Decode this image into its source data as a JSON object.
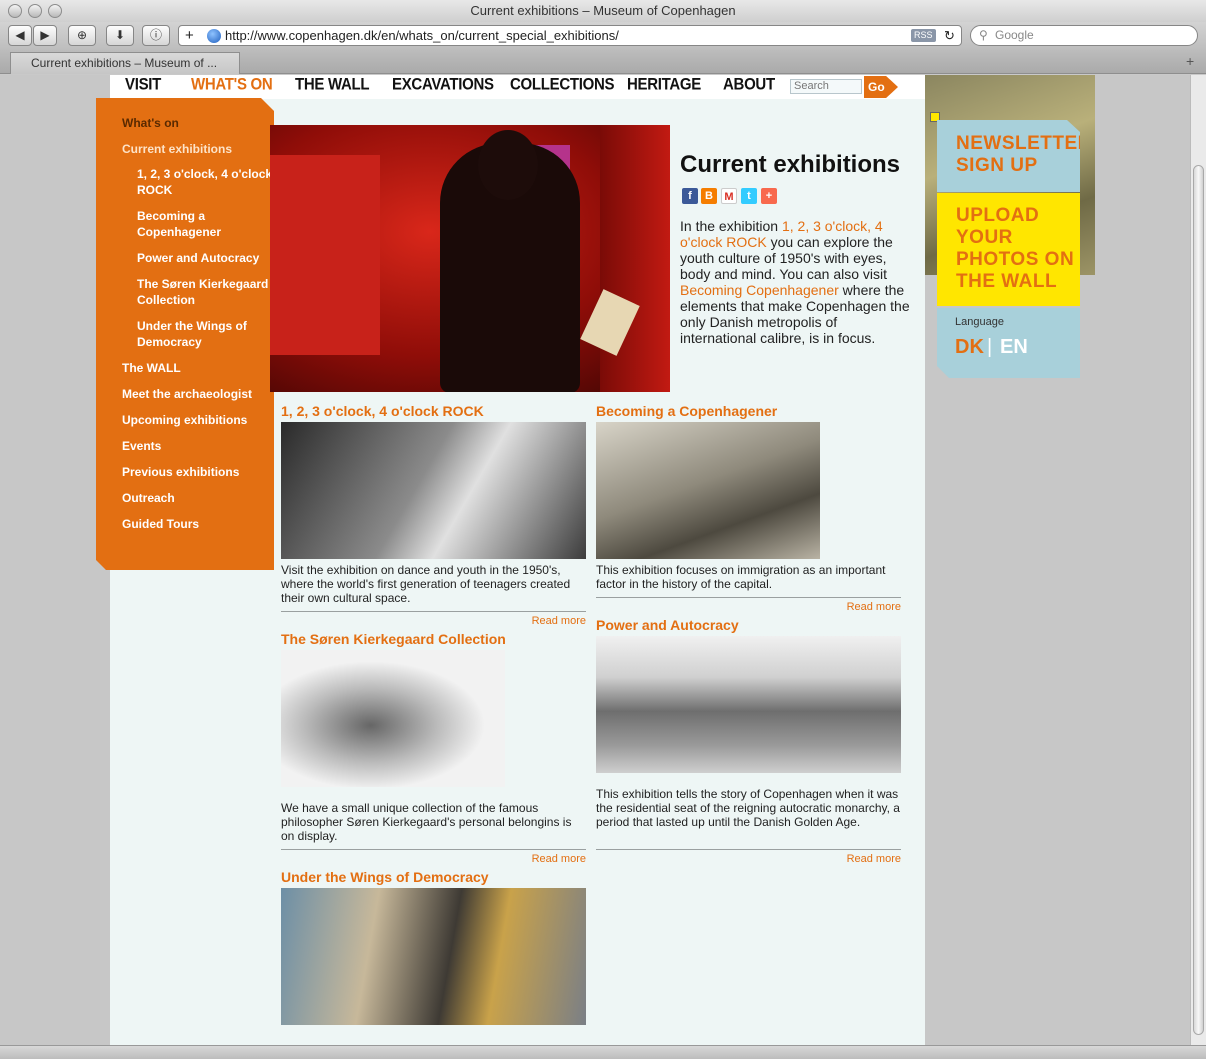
{
  "window": {
    "title": "Current exhibitions – Museum of Copenhagen"
  },
  "browser": {
    "url": "http://www.copenhagen.dk/en/whats_on/current_special_exhibitions/",
    "rss": "RSS",
    "search_placeholder": "Google",
    "tab_label": "Current exhibitions – Museum of ..."
  },
  "nav": {
    "items": [
      "VISIT",
      "WHAT'S ON",
      "THE WALL",
      "EXCAVATIONS",
      "COLLECTIONS",
      "HERITAGE",
      "ABOUT"
    ],
    "search_placeholder": "Search",
    "go": "Go"
  },
  "submenu": {
    "head": "What's on",
    "current": "Current exhibitions",
    "sub": [
      "1, 2, 3 o'clock, 4 o'clock ROCK",
      "Becoming a Copenhagener",
      "Power and Autocracy",
      "The Søren Kierkegaard Collection",
      "Under the Wings of Democracy"
    ],
    "items": [
      "The WALL",
      "Meet the archaeologist",
      "Upcoming exhibitions",
      "Events",
      "Previous exhibitions",
      "Outreach",
      "Guided Tours"
    ]
  },
  "main": {
    "title": "Current exhibitions",
    "intro": {
      "p1": "In the exhibition ",
      "link1": "1, 2, 3 o'clock, 4 o'clock ROCK",
      "p2": " you can explore the youth culture of 1950's with eyes, body and mind. You can also visit ",
      "link2": "Becoming Copenhagener",
      "p3": " where the elements that make Copenhagen the only Danish metropolis of international calibre, is in focus."
    },
    "exhibitions": [
      {
        "title": "1, 2, 3 o'clock, 4 o'clock ROCK",
        "desc": "Visit the exhibition on dance and youth in the 1950's, where the world's first generation of teenagers created their own cultural space.",
        "readmore": "Read more"
      },
      {
        "title": "Becoming a Copenhagener",
        "desc": "This exhibition focuses on immigration as an important factor in the history of the capital.",
        "readmore": "Read more"
      },
      {
        "title": "The Søren Kierkegaard Collection",
        "desc": "We have a small unique collection of the famous philosopher Søren Kierkegaard's personal belongins is on display.",
        "readmore": "Read more"
      },
      {
        "title": "Power and Autocracy",
        "desc": "This exhibition tells the story of Copenhagen when it was the residential seat of the reigning autocratic monarchy, a period that lasted up until the Danish Golden Age.",
        "readmore": "Read more"
      },
      {
        "title": "Under the Wings of Democracy",
        "desc": "",
        "readmore": ""
      }
    ]
  },
  "sidebar": {
    "newsletter": [
      "NEWSLETTER",
      "SIGN UP"
    ],
    "upload": [
      "UPLOAD",
      "YOUR",
      "PHOTOS ON",
      "THE WALL"
    ],
    "language_label": "Language",
    "dk": "DK",
    "sep": "|",
    "en": "EN"
  },
  "colors": {
    "accent": "#e36f12",
    "page_bg": "#eef6f5",
    "promo_blue": "#a8d0da",
    "promo_yellow": "#ffe600"
  }
}
